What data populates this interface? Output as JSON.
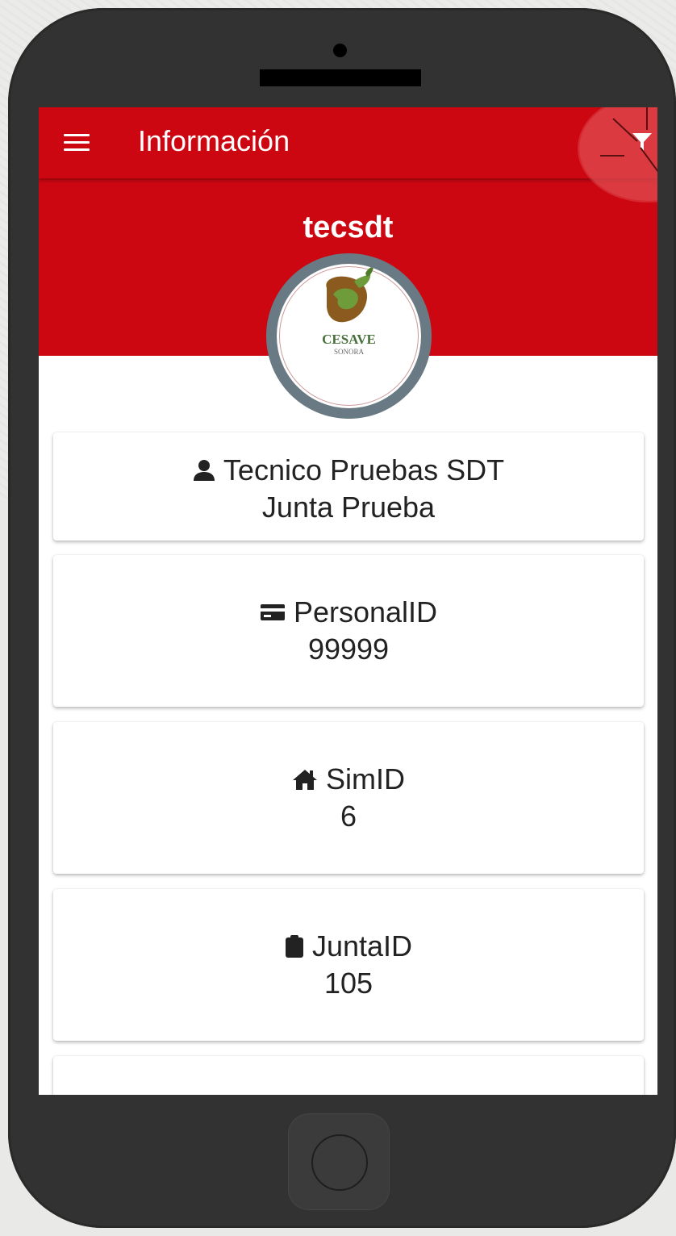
{
  "appbar": {
    "title": "Información",
    "menu_icon": "hamburger-menu-icon",
    "filter_icon": "filter-icon",
    "background": "#cc0711"
  },
  "profile": {
    "username": "tecsdt",
    "logo": {
      "name": "CESAVE",
      "subtitle": "SONORA"
    }
  },
  "cards": [
    {
      "icon": "person-icon",
      "label": "Tecnico Pruebas SDT",
      "value": "Junta Prueba"
    },
    {
      "icon": "id-card-icon",
      "label": "PersonalID",
      "value": "99999"
    },
    {
      "icon": "home-icon",
      "label": "SimID",
      "value": "6"
    },
    {
      "icon": "clipboard-icon",
      "label": "JuntaID",
      "value": "105"
    }
  ],
  "colors": {
    "accent": "#cc0711",
    "avatar_ring": "#697a84",
    "phone_body": "#323232"
  }
}
